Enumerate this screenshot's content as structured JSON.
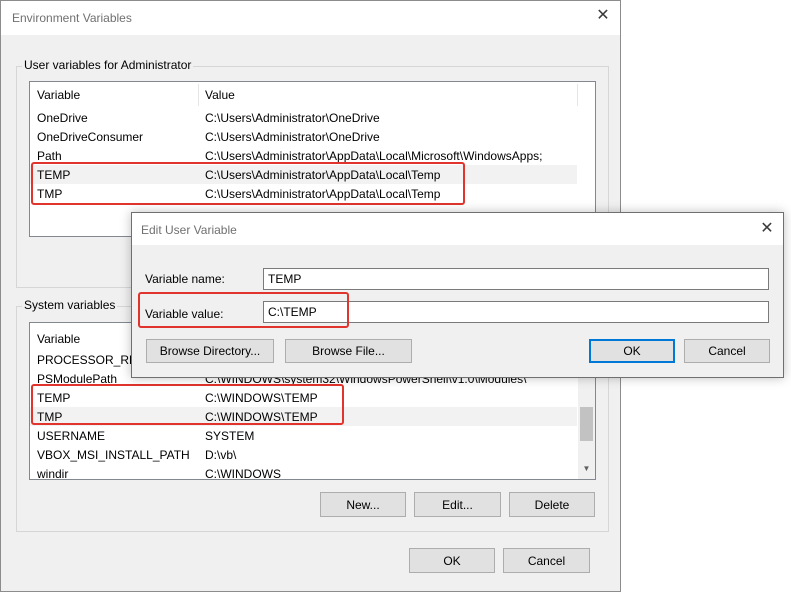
{
  "env_window": {
    "title": "Environment Variables",
    "user_group_label": "User variables for Administrator",
    "user_list": {
      "headers": [
        "Variable",
        "Value"
      ],
      "rows": [
        {
          "variable": "OneDrive",
          "value": "C:\\Users\\Administrator\\OneDrive"
        },
        {
          "variable": "OneDriveConsumer",
          "value": "C:\\Users\\Administrator\\OneDrive"
        },
        {
          "variable": "Path",
          "value": "C:\\Users\\Administrator\\AppData\\Local\\Microsoft\\WindowsApps;"
        },
        {
          "variable": "TEMP",
          "value": "C:\\Users\\Administrator\\AppData\\Local\\Temp"
        },
        {
          "variable": "TMP",
          "value": "C:\\Users\\Administrator\\AppData\\Local\\Temp"
        }
      ]
    },
    "system_group_label": "System variables",
    "system_list": {
      "headers": [
        "Variable",
        "Value"
      ],
      "rows": [
        {
          "variable": "PROCESSOR_REVISION",
          "value": ""
        },
        {
          "variable": "PSModulePath",
          "value": "C:\\WINDOWS\\system32\\WindowsPowerShell\\v1.0\\Modules\\"
        },
        {
          "variable": "TEMP",
          "value": "C:\\WINDOWS\\TEMP"
        },
        {
          "variable": "TMP",
          "value": "C:\\WINDOWS\\TEMP"
        },
        {
          "variable": "USERNAME",
          "value": "SYSTEM"
        },
        {
          "variable": "VBOX_MSI_INSTALL_PATH",
          "value": "D:\\vb\\"
        },
        {
          "variable": "windir",
          "value": "C:\\WINDOWS"
        }
      ]
    },
    "buttons": {
      "new": "New...",
      "edit": "Edit...",
      "delete": "Delete",
      "ok": "OK",
      "cancel": "Cancel"
    }
  },
  "edit_dialog": {
    "title": "Edit User Variable",
    "name_label": "Variable name:",
    "name_value": "TEMP",
    "value_label": "Variable value:",
    "value_value": "C:\\TEMP",
    "buttons": {
      "browse_directory": "Browse Directory...",
      "browse_file": "Browse File...",
      "ok": "OK",
      "cancel": "Cancel"
    }
  },
  "highlight_color": "#e0342d"
}
